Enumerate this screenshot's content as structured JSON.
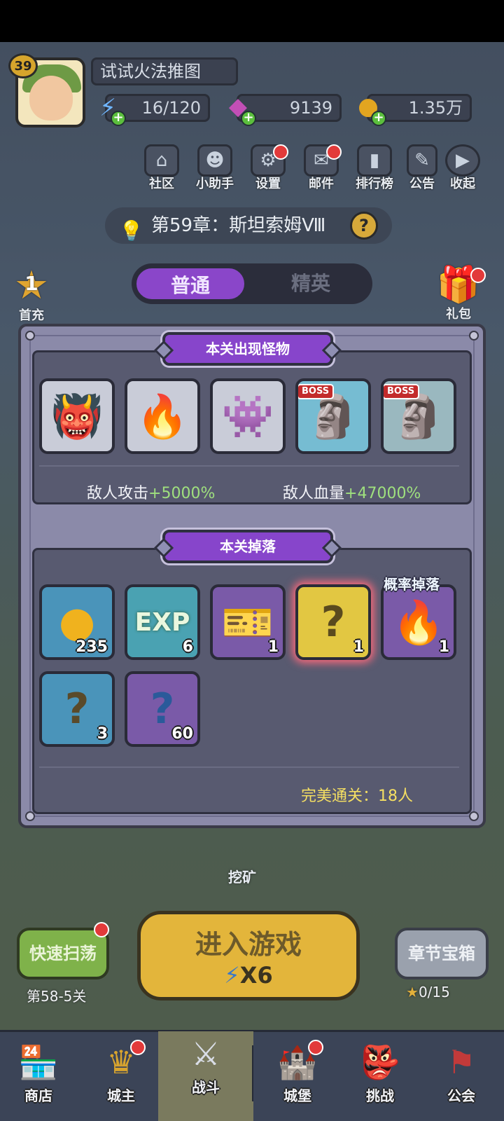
{
  "player": {
    "level": "39",
    "name": "试试火法推图"
  },
  "resources": {
    "energy": "16/120",
    "gems": "9139",
    "gold": "1.35万"
  },
  "top_icons": [
    {
      "label": "社区",
      "icon": "community-icon"
    },
    {
      "label": "小助手",
      "icon": "assistant-icon"
    },
    {
      "label": "设置",
      "icon": "settings-icon"
    },
    {
      "label": "邮件",
      "icon": "mail-icon"
    },
    {
      "label": "排行榜",
      "icon": "ranking-icon"
    },
    {
      "label": "公告",
      "icon": "notice-icon"
    },
    {
      "label": "收起",
      "icon": "collapse-icon"
    }
  ],
  "chapter": "第59章：斯坦索姆Ⅷ",
  "modes": {
    "normal": "普通",
    "elite": "精英"
  },
  "side": {
    "first_clear_count": "1",
    "first_clear": "首充",
    "gift": "礼包"
  },
  "modal": {
    "monsters_title": "本关出现怪物",
    "boss_tag": "BOSS",
    "enemy_attack_label": "敌人攻击",
    "enemy_attack_value": "+5000%",
    "enemy_hp_label": "敌人血量",
    "enemy_hp_value": "+47000%",
    "drops_title": "本关掉落",
    "prob_drop": "概率掉落",
    "drops": [
      {
        "qty": "235",
        "icon": "gold-coin-icon"
      },
      {
        "qty": "6",
        "icon": "exp-icon",
        "text": "EXP"
      },
      {
        "qty": "1",
        "icon": "ticket-icon"
      },
      {
        "qty": "1",
        "icon": "mystery-gems-icon"
      },
      {
        "qty": "1",
        "icon": "fire-crystal-icon"
      },
      {
        "qty": "3",
        "icon": "mystery-scroll-icon"
      },
      {
        "qty": "60",
        "icon": "mystery-puzzle-icon"
      }
    ],
    "perfect_clear": "完美通关：18人"
  },
  "mine_label": "挖矿",
  "quick_sweep": {
    "label": "快速扫荡",
    "stage": "第58-5关"
  },
  "enter_game": {
    "label": "进入游戏",
    "cost": "X6"
  },
  "chapter_chest": {
    "label": "章节宝箱",
    "progress": "0/15"
  },
  "nav": [
    "商店",
    "城主",
    "战斗",
    "城堡",
    "挑战",
    "公会"
  ]
}
